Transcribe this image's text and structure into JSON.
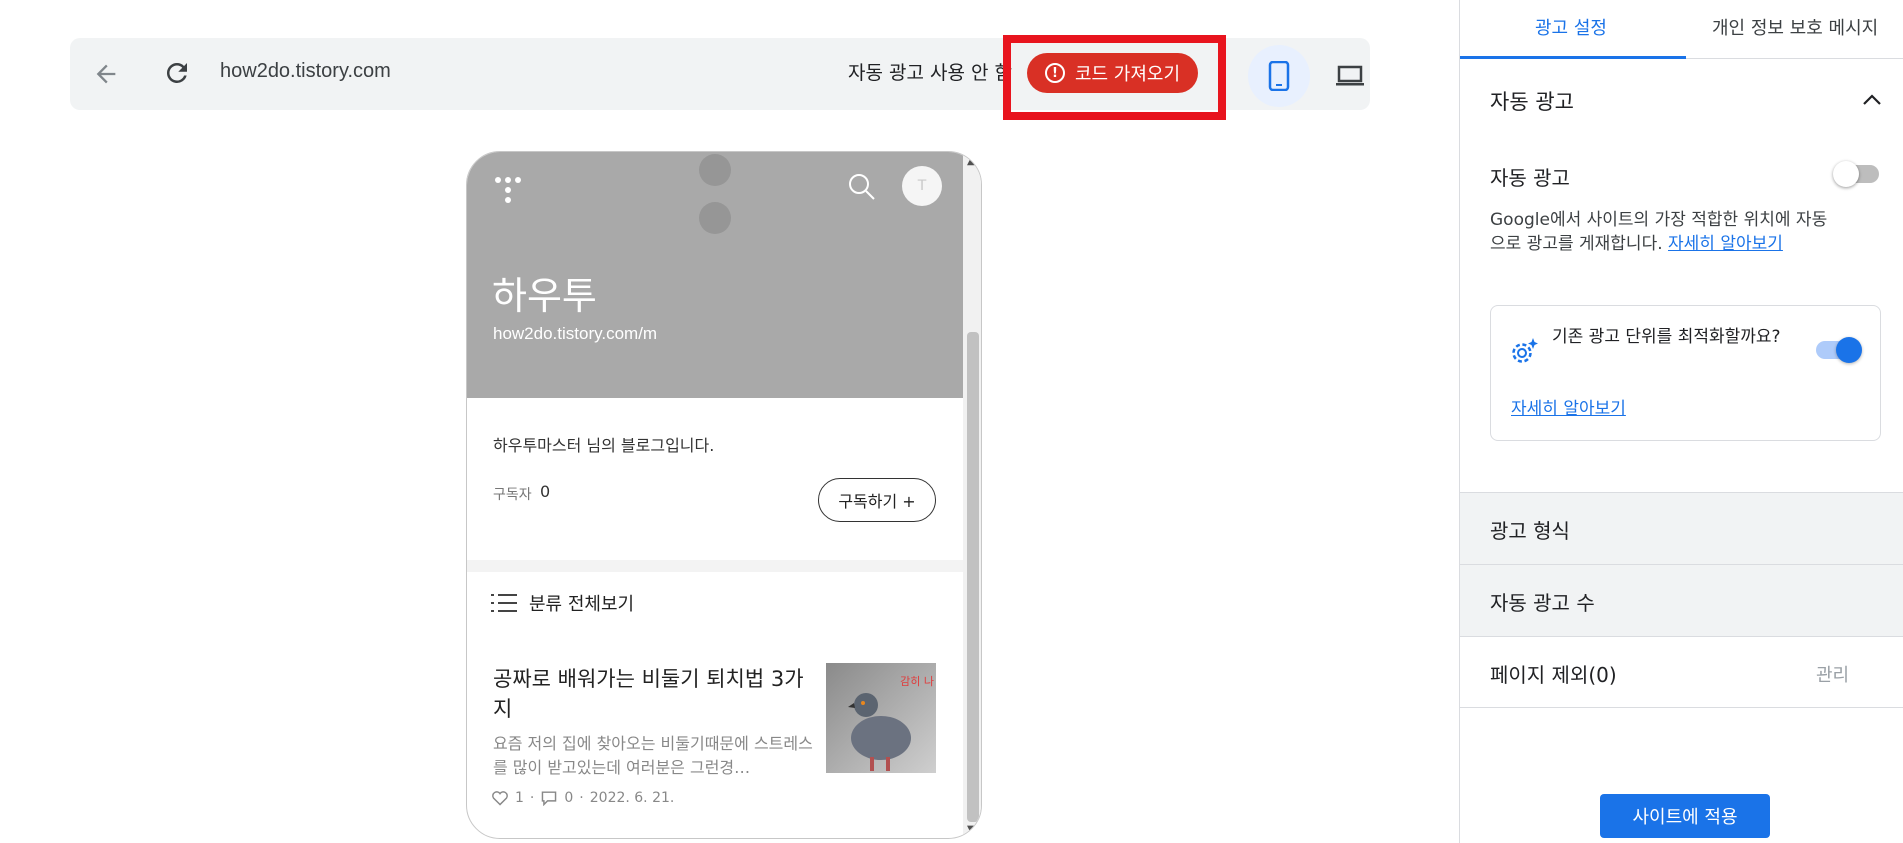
{
  "toolbar": {
    "url": "how2do.tistory.com",
    "auto_ads_status": "자동 광고 사용 안 함",
    "get_code_label": "코드 가져오기",
    "error_symbol": "!"
  },
  "preview": {
    "avatar_initial": "T",
    "blog_title": "하우투",
    "blog_url": "how2do.tistory.com/m",
    "description": "하우투마스터 님의 블로그입니다.",
    "subscribers_label": "구독자",
    "subscribers_count": "0",
    "subscribe_label": "구독하기 +",
    "category_label": "분류 전체보기",
    "post": {
      "title": "공짜로 배워가는 비둘기 퇴치법 3가지",
      "excerpt": "요즘 저의 집에 찾아오는 비둘기때문에 스트레스를 많이 받고있는데 여러분은 그런경…",
      "thumb_badge": "감히 나",
      "likes": "1",
      "comments": "0",
      "date": "2022. 6. 21."
    }
  },
  "panel": {
    "tabs": [
      {
        "label": "광고 설정",
        "active": true
      },
      {
        "label": "개인 정보 보호 메시지",
        "active": false
      }
    ],
    "section_title": "자동 광고",
    "auto_ads_label": "자동 광고",
    "auto_ads_enabled": false,
    "description": "Google에서 사이트의 가장 적합한 위치에 자동으로 광고를 게재합니다.",
    "learn_more_inline": "자세히 알아보기",
    "optimize_question": "기존 광고 단위를 최적화할까요?",
    "optimize_enabled": true,
    "learn_more": "자세히 알아보기",
    "ad_formats_label": "광고 형식",
    "ad_load_label": "자동 광고 수",
    "page_exclusions_label": "페이지 제외(0)",
    "manage_label": "관리",
    "apply_label": "사이트에 적용"
  },
  "colors": {
    "accent": "#1a73e8",
    "error_red": "#d93025",
    "highlight_frame": "#e8141e",
    "preview_header": "#a9a9a9"
  }
}
